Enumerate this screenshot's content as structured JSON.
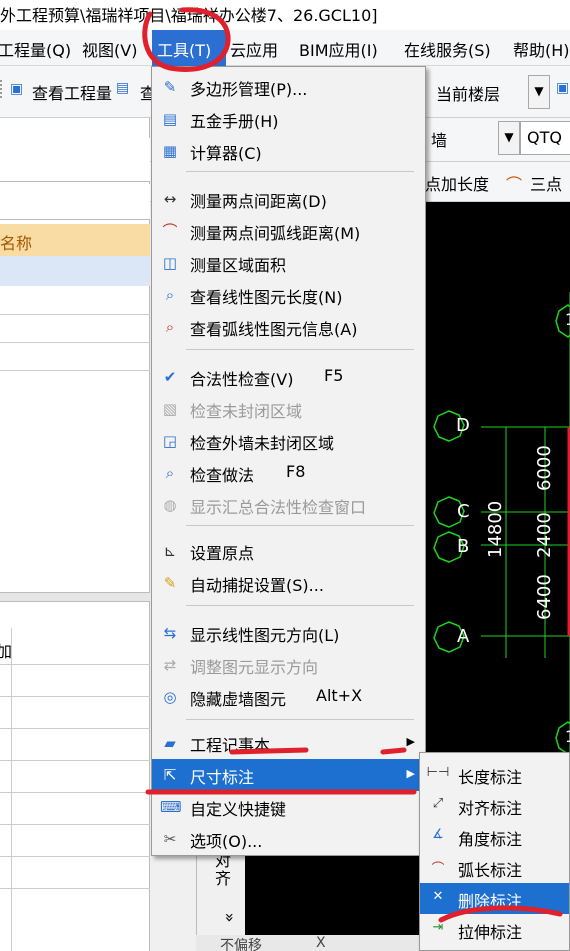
{
  "window": {
    "title": "外工程预算\\福瑞祥项目\\福瑞祥办公楼7、26.GCL10]"
  },
  "menubar": {
    "items": [
      {
        "label": "工程量(Q)"
      },
      {
        "label": "视图(V)"
      },
      {
        "label": "工具(T)"
      },
      {
        "label": "云应用"
      },
      {
        "label": "BIM应用(I)"
      },
      {
        "label": "在线服务(S)"
      },
      {
        "label": "帮助(H)"
      }
    ]
  },
  "toolbar": {
    "view_quantity": "查看工程量",
    "view_quantity_2": "查",
    "floor_combo": "当前楼层",
    "wall_combo": "墙",
    "qtq_combo": "QTQ",
    "point_length": "点加长度",
    "three_point": "三点"
  },
  "left_pane": {
    "name_header": "名称",
    "bottom_label": "加"
  },
  "tools_menu": {
    "items": [
      {
        "icon": "polygon-manage-icon",
        "label": "多边形管理(P)...",
        "shortcut": "",
        "enabled": true
      },
      {
        "icon": "hardware-manual-icon",
        "label": "五金手册(H)",
        "shortcut": "",
        "enabled": true
      },
      {
        "icon": "calculator-icon",
        "label": "计算器(C)",
        "shortcut": "",
        "enabled": true
      },
      {
        "icon": "measure-distance-icon",
        "label": "测量两点间距离(D)",
        "shortcut": "",
        "enabled": true
      },
      {
        "icon": "measure-arc-icon",
        "label": "测量两点间弧线距离(M)",
        "shortcut": "",
        "enabled": true
      },
      {
        "icon": "measure-area-icon",
        "label": "测量区域面积",
        "shortcut": "",
        "enabled": true
      },
      {
        "icon": "linear-length-icon",
        "label": "查看线性图元长度(N)",
        "shortcut": "",
        "enabled": true
      },
      {
        "icon": "arc-info-icon",
        "label": "查看弧线性图元信息(A)",
        "shortcut": "",
        "enabled": true
      },
      {
        "icon": "validity-check-icon",
        "label": "合法性检查(V)",
        "shortcut": "F5",
        "enabled": true
      },
      {
        "icon": "unclosed-area-icon",
        "label": "检查未封闭区域",
        "shortcut": "",
        "enabled": false
      },
      {
        "icon": "outer-wall-icon",
        "label": "检查外墙未封闭区域",
        "shortcut": "",
        "enabled": true
      },
      {
        "icon": "check-method-icon",
        "label": "检查做法",
        "shortcut": "F8",
        "enabled": true
      },
      {
        "icon": "summary-window-icon",
        "label": "显示汇总合法性检查窗口",
        "shortcut": "",
        "enabled": false
      },
      {
        "icon": "set-origin-icon",
        "label": "设置原点",
        "shortcut": "",
        "enabled": true
      },
      {
        "icon": "snap-settings-icon",
        "label": "自动捕捉设置(S)...",
        "shortcut": "",
        "enabled": true
      },
      {
        "icon": "line-direction-icon",
        "label": "显示线性图元方向(L)",
        "shortcut": "",
        "enabled": true
      },
      {
        "icon": "adjust-direction-icon",
        "label": "调整图元显示方向",
        "shortcut": "",
        "enabled": false
      },
      {
        "icon": "hide-wall-icon",
        "label": "隐藏虚墙图元",
        "shortcut": "Alt+X",
        "enabled": true
      },
      {
        "icon": "notebook-icon",
        "label": "工程记事本",
        "shortcut": "",
        "enabled": true
      },
      {
        "icon": "dimension-icon",
        "label": "尺寸标注",
        "shortcut": "",
        "enabled": true
      },
      {
        "icon": "shortcut-key-icon",
        "label": "自定义快捷键",
        "shortcut": "",
        "enabled": true
      },
      {
        "icon": "options-icon",
        "label": "选项(O)...",
        "shortcut": "",
        "enabled": true
      }
    ]
  },
  "dimension_submenu": {
    "items": [
      {
        "icon": "length-dim-icon",
        "label": "长度标注"
      },
      {
        "icon": "aligned-dim-icon",
        "label": "对齐标注"
      },
      {
        "icon": "angle-dim-icon",
        "label": "角度标注"
      },
      {
        "icon": "arc-dim-icon",
        "label": "弧长标注"
      },
      {
        "icon": "delete-dim-icon",
        "label": "删除标注"
      },
      {
        "icon": "stretch-dim-icon",
        "label": "拉伸标注"
      }
    ]
  },
  "canvas": {
    "axes": [
      "D",
      "C",
      "B",
      "A"
    ],
    "axis_top": "1",
    "axis_bottom": "1",
    "dim_total": "14800",
    "dim_parts": [
      "6000",
      "2400",
      "6400"
    ]
  },
  "side_panel": {
    "align_label": "对齐",
    "chevron": "»"
  },
  "statusbar": {
    "text": "不偏移",
    "x_label": "X"
  },
  "colors": {
    "menu_highlight": "#1d6fd0",
    "canvas": "#000000",
    "axis_green": "#1fd21f",
    "annotation_red": "#e0202a"
  }
}
